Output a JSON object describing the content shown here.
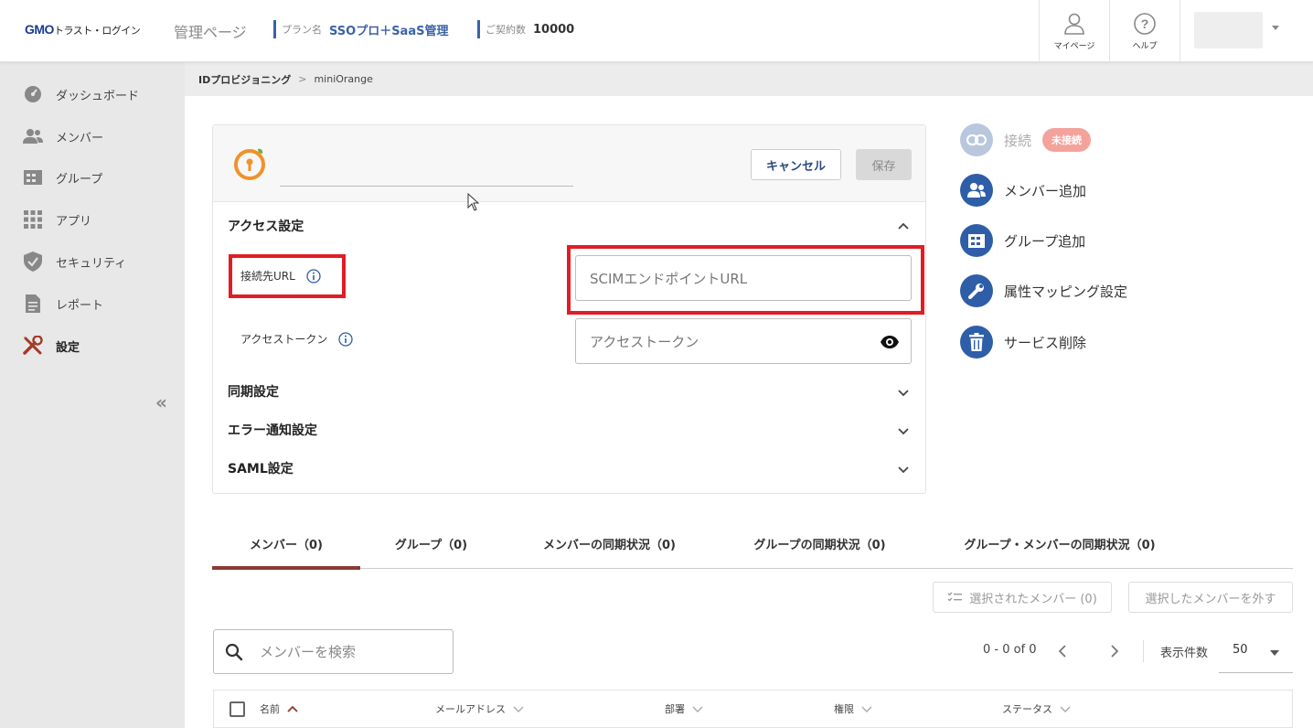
{
  "header": {
    "logo_gmo": "GMO",
    "logo_rest": "トラスト・ログイン",
    "admin_title": "管理ページ",
    "plan_label": "プラン名",
    "plan_value": "SSOプロ＋SaaS管理",
    "contract_label": "ご契約数",
    "contract_value": "10000",
    "mypage_label": "マイページ",
    "help_label": "ヘルプ"
  },
  "sidebar": {
    "items": [
      {
        "label": "ダッシュボード",
        "icon": "dashboard-icon"
      },
      {
        "label": "メンバー",
        "icon": "members-icon"
      },
      {
        "label": "グループ",
        "icon": "group-icon"
      },
      {
        "label": "アプリ",
        "icon": "apps-icon"
      },
      {
        "label": "セキュリティ",
        "icon": "shield-icon"
      },
      {
        "label": "レポート",
        "icon": "report-icon"
      },
      {
        "label": "設定",
        "icon": "tools-icon",
        "active": true
      }
    ],
    "collapse_glyph": "«"
  },
  "breadcrumb": {
    "parent": "IDプロビジョニング",
    "separator": ">",
    "current": "miniOrange"
  },
  "card": {
    "cancel_label": "キャンセル",
    "save_label": "保存",
    "access_section": "アクセス設定",
    "url_label": "接続先URL",
    "url_placeholder": "SCIMエンドポイントURL",
    "token_label": "アクセストークン",
    "token_placeholder": "アクセストークン",
    "sync_section": "同期設定",
    "error_section": "エラー通知設定",
    "saml_section": "SAML設定"
  },
  "actions": {
    "connect_label": "接続",
    "connect_status": "未接続",
    "add_member": "メンバー追加",
    "add_group": "グループ追加",
    "attr_mapping": "属性マッピング設定",
    "delete_service": "サービス削除"
  },
  "tabs": [
    {
      "label": "メンバー（0)",
      "active": true
    },
    {
      "label": "グループ（0)"
    },
    {
      "label": "メンバーの同期状況（0)"
    },
    {
      "label": "グループの同期状況（0)"
    },
    {
      "label": "グループ・メンバーの同期状況（0)"
    }
  ],
  "table": {
    "selected_members_btn": "選択されたメンバー (0)",
    "remove_selected_btn": "選択したメンバーを外す",
    "search_placeholder": "メンバーを検索",
    "range_text": "0 - 0 of 0",
    "per_page_label": "表示件数",
    "per_page_value": "50",
    "columns": [
      "名前",
      "メールアドレス",
      "部署",
      "権限",
      "ステータス"
    ]
  },
  "colors": {
    "brand_blue": "#2f5ea8",
    "alert_red": "#e21c25",
    "tab_underline": "#8b3a32",
    "badge_bg": "#f3a39c"
  }
}
